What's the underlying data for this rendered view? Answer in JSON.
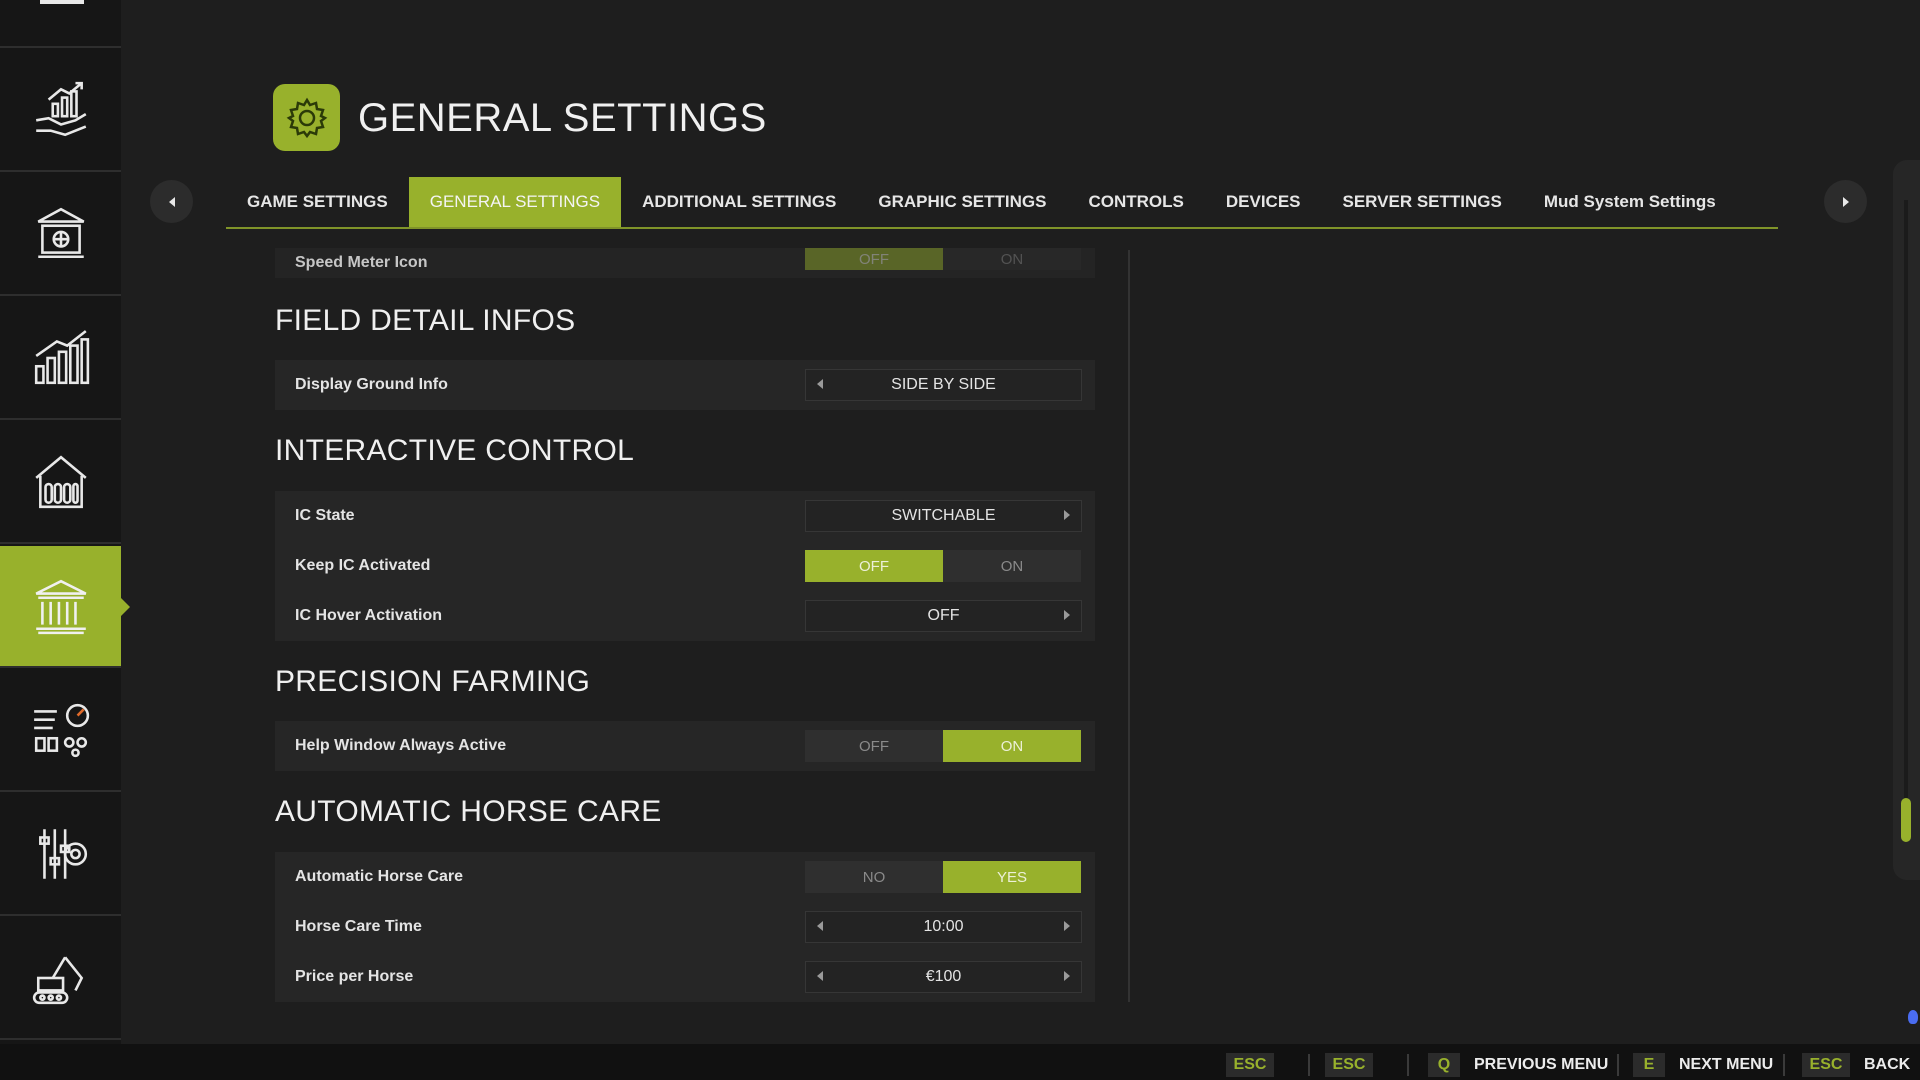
{
  "header": {
    "title": "GENERAL SETTINGS",
    "icon": "gear-icon"
  },
  "tabs": [
    {
      "label": "GAME SETTINGS",
      "active": false
    },
    {
      "label": "GENERAL SETTINGS",
      "active": true
    },
    {
      "label": "ADDITIONAL SETTINGS",
      "active": false
    },
    {
      "label": "GRAPHIC SETTINGS",
      "active": false
    },
    {
      "label": "CONTROLS",
      "active": false
    },
    {
      "label": "DEVICES",
      "active": false
    },
    {
      "label": "SERVER SETTINGS",
      "active": false
    },
    {
      "label": "Mud System Settings",
      "active": false
    }
  ],
  "sidebar": {
    "items": [
      {
        "icon": "finance-hand-chart-icon"
      },
      {
        "icon": "bank-vault-icon"
      },
      {
        "icon": "statistics-bars-icon"
      },
      {
        "icon": "animal-barn-icon"
      },
      {
        "icon": "institution-building-icon",
        "active": true
      },
      {
        "icon": "settings-sliders-gauge-icon"
      },
      {
        "icon": "gear-sliders-icon"
      },
      {
        "icon": "construction-excavator-icon"
      }
    ]
  },
  "settings": {
    "speed_meter": {
      "label": "Speed Meter Icon",
      "off": "OFF",
      "on": "ON",
      "value": "OFF"
    },
    "field_detail": {
      "title": "FIELD DETAIL INFOS",
      "display_ground_info": {
        "label": "Display Ground Info",
        "value": "SIDE BY SIDE"
      }
    },
    "interactive_control": {
      "title": "INTERACTIVE CONTROL",
      "ic_state": {
        "label": "IC State",
        "value": "SWITCHABLE"
      },
      "keep_ic": {
        "label": "Keep IC Activated",
        "off": "OFF",
        "on": "ON",
        "value": "OFF"
      },
      "ic_hover": {
        "label": "IC Hover Activation",
        "value": "OFF"
      }
    },
    "precision_farming": {
      "title": "PRECISION FARMING",
      "help_window": {
        "label": "Help Window Always Active",
        "off": "OFF",
        "on": "ON",
        "value": "ON"
      }
    },
    "horse_care": {
      "title": "AUTOMATIC HORSE CARE",
      "auto": {
        "label": "Automatic Horse Care",
        "no": "NO",
        "yes": "YES",
        "value": "YES"
      },
      "time": {
        "label": "Horse Care Time",
        "value": "10:00"
      },
      "price": {
        "label": "Price per Horse",
        "value": "€100"
      }
    }
  },
  "footer": {
    "keys": [
      {
        "key": "ESC",
        "label": ""
      },
      {
        "key": "ESC",
        "label": ""
      },
      {
        "key": "Q",
        "label": "PREVIOUS MENU"
      },
      {
        "key": "E",
        "label": "NEXT MENU"
      },
      {
        "key": "ESC",
        "label": "BACK"
      }
    ]
  },
  "colors": {
    "accent": "#98b12c",
    "background": "#1e1e1e",
    "row": "#262626"
  }
}
